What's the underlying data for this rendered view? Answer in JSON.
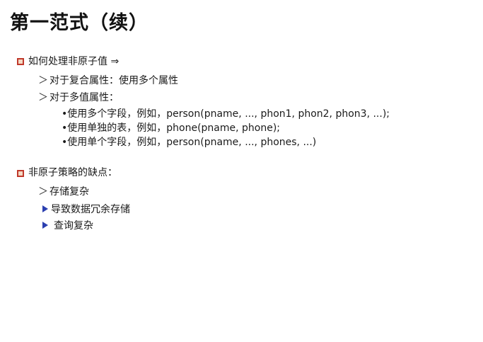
{
  "title": "第一范式（续）",
  "section1": {
    "heading": "如何处理非原子值 ⇒",
    "items": [
      "对于复合属性：使用多个属性",
      "对于多值属性："
    ],
    "subitems": [
      "•使用多个字段，例如，person(pname, ..., phon1, phon2, phon3, ...);",
      "•使用单独的表，例如，phone(pname, phone);",
      "•使用单个字段，例如，person(pname, ..., phones, ...)"
    ]
  },
  "section2": {
    "heading": "非原子策略的缺点：",
    "item": "存储复杂",
    "arrow_items": [
      "导致数据冗余存储",
      "查询复杂"
    ]
  },
  "symbols": {
    "gt": "＞"
  },
  "colors": {
    "bullet_border": "#c0392b",
    "bullet_fill": "#f4d9c4",
    "arrow": "#2b3fb0"
  }
}
